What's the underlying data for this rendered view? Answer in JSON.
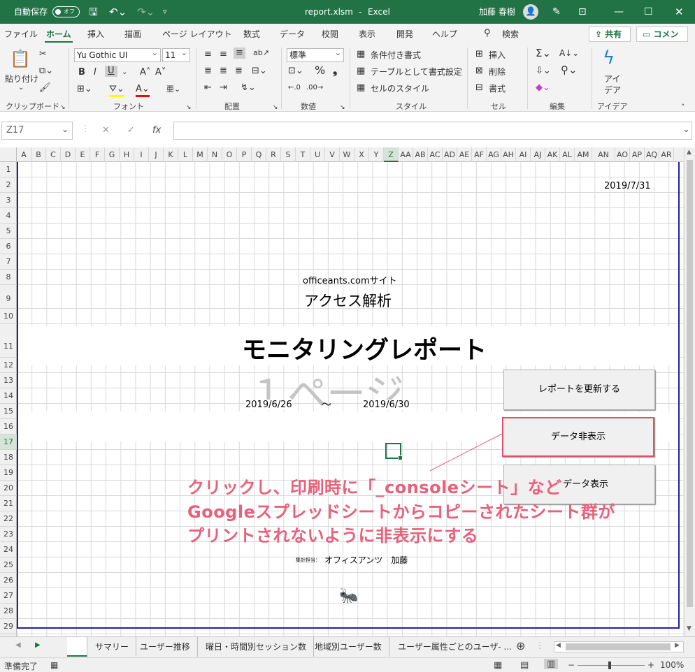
{
  "titlebar": {
    "autosave_label": "自動保存",
    "autosave_state": "オフ",
    "filename": "report.xlsm",
    "separator": "-",
    "app": "Excel",
    "user": "加藤 春樹"
  },
  "menu": {
    "items": [
      "ファイル",
      "ホーム",
      "挿入",
      "描画",
      "ページ レイアウト",
      "数式",
      "データ",
      "校閲",
      "表示",
      "開発",
      "ヘルプ"
    ],
    "active": "ホーム",
    "search": "検索",
    "share": "共有",
    "comment": "コメント"
  },
  "ribbon": {
    "clipboard": {
      "paste": "貼り付け",
      "group": "クリップボード"
    },
    "font": {
      "name": "Yu Gothic UI",
      "size": "11",
      "group": "フォント"
    },
    "alignment": {
      "group": "配置"
    },
    "number": {
      "format": "標準",
      "group": "数値"
    },
    "styles": {
      "conditional": "条件付き書式",
      "table": "テーブルとして書式設定",
      "cell": "セルのスタイル",
      "group": "スタイル"
    },
    "cells": {
      "insert": "挿入",
      "delete": "削除",
      "format": "書式",
      "group": "セル"
    },
    "editing": {
      "group": "編集"
    },
    "ideas": {
      "label1": "アイ",
      "label2": "デア",
      "group": "アイデア"
    }
  },
  "formula_bar": {
    "name_box": "Z17",
    "formula": ""
  },
  "columns": [
    "A",
    "B",
    "C",
    "D",
    "E",
    "F",
    "G",
    "H",
    "I",
    "J",
    "K",
    "L",
    "M",
    "N",
    "O",
    "P",
    "Q",
    "R",
    "S",
    "T",
    "U",
    "V",
    "W",
    "X",
    "Y",
    "Z",
    "AA",
    "AB",
    "AC",
    "AD",
    "AE",
    "AF",
    "AG",
    "AH",
    "AI",
    "AJ",
    "AK",
    "AL",
    "AM",
    "AN",
    "AO",
    "AP",
    "AQ",
    "AR"
  ],
  "selected_column": "Z",
  "rows": [
    "1",
    "2",
    "3",
    "4",
    "5",
    "6",
    "7",
    "8",
    "9",
    "10",
    "11",
    "12",
    "13",
    "14",
    "15",
    "16",
    "17",
    "18",
    "19",
    "20",
    "21",
    "22",
    "23",
    "24",
    "25",
    "26",
    "27",
    "28",
    "29"
  ],
  "selected_row": "17",
  "sheet": {
    "date": "2019/7/31",
    "site": "officeants.comサイト",
    "subtitle": "アクセス解析",
    "title": "モニタリングレポート",
    "watermark": "１ページ",
    "start_date": "2019/6/26",
    "tilde": "～",
    "end_date": "2019/6/30",
    "staff_label": "集計担当：",
    "staff_name": "オフィスアンツ　加藤"
  },
  "buttons": {
    "update": "レポートを更新する",
    "hide": "データ非表示",
    "show": "データ表示"
  },
  "annotation": {
    "line1": "クリックし、印刷時に「_consoleシート」など",
    "line2": "Googleスプレッドシートからコピーされたシート群が",
    "line3": "プリントされないように非表示にする"
  },
  "sheet_tabs": [
    "",
    "サマリー",
    "ユーザー推移",
    "曜日・時間別セッション数",
    "地域別ユーザー数",
    "ユーザー属性ごとのユーザ- ..."
  ],
  "status": {
    "ready": "準備完了",
    "zoom": "100%"
  },
  "colors": {
    "accent": "#217346",
    "annotation": "#e8607a",
    "print_border": "#1f1fb0"
  }
}
